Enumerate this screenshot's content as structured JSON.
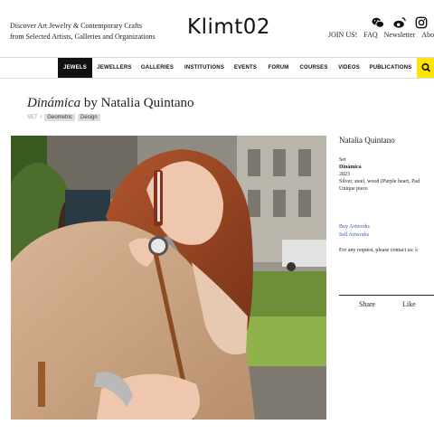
{
  "header": {
    "tagline_line1": "Discover Art Jewelry & Contemporary Crafts",
    "tagline_line2": "from Selected Artists, Galleries and Organizations",
    "logo": "Klimt02",
    "social_icons": [
      "wechat-icon",
      "weibo-icon",
      "instagram-icon"
    ],
    "links": [
      "JOIN US!",
      "FAQ",
      "Newsletter",
      "Abo"
    ]
  },
  "nav": {
    "items": [
      "JEWELS",
      "JEWELLERS",
      "GALLERIES",
      "INSTITUTIONS",
      "EVENTS",
      "FORUM",
      "COURSES",
      "VIDEOS",
      "PUBLICATIONS"
    ],
    "active": "JEWELS",
    "search_icon": "search-icon",
    "accent": "#ffe400"
  },
  "main": {
    "title_italic": "Dinámica",
    "title_rest": " by Natalia Quintano",
    "crumb_label": "SET",
    "crumb_sep": "/",
    "tags": [
      "Geometric",
      "Design"
    ]
  },
  "side": {
    "artist": "Natalia Quintano",
    "type": "Set",
    "piece_name": "Dinámica",
    "year": "2023",
    "materials": "Silver, steel, wood (Purple heart, Pad",
    "unique": "Unique piece",
    "buy": "Buy Artworks",
    "sell": "Sell Artworks",
    "contact_text": "For any request, please contact us: ",
    "contact_link": "k",
    "share": "Share",
    "like": "Like"
  }
}
